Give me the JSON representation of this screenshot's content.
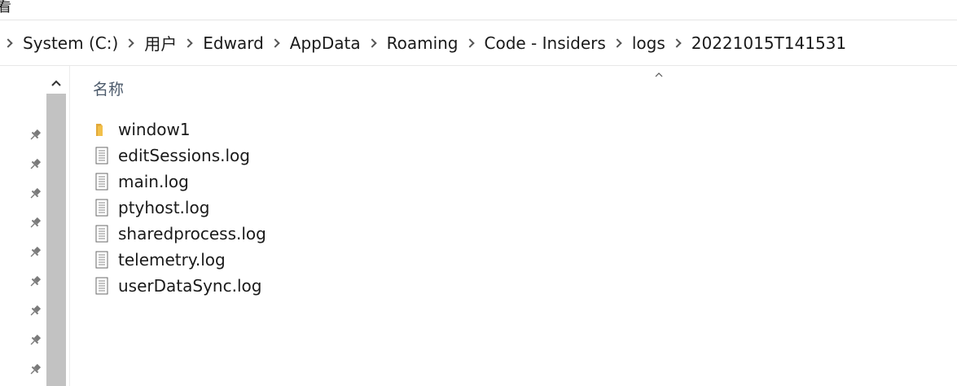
{
  "ribbon": {
    "fragment": "看"
  },
  "breadcrumb": {
    "items": [
      "System (C:)",
      "用户",
      "Edward",
      "AppData",
      "Roaming",
      "Code - Insiders",
      "logs",
      "20221015T141531"
    ]
  },
  "columns": {
    "name_header": "名称"
  },
  "files": [
    {
      "name": "window1",
      "type": "folder",
      "icon": "folder-icon"
    },
    {
      "name": "editSessions.log",
      "type": "file",
      "icon": "document-icon"
    },
    {
      "name": "main.log",
      "type": "file",
      "icon": "document-icon"
    },
    {
      "name": "ptyhost.log",
      "type": "file",
      "icon": "document-icon"
    },
    {
      "name": "sharedprocess.log",
      "type": "file",
      "icon": "document-icon"
    },
    {
      "name": "telemetry.log",
      "type": "file",
      "icon": "document-icon"
    },
    {
      "name": "userDataSync.log",
      "type": "file",
      "icon": "document-icon"
    }
  ],
  "quick_access": {
    "pinned_count": 9,
    "icon": "pin-icon"
  },
  "colors": {
    "folder": "#f2c04a",
    "scroll_thumb": "#c2c2c2",
    "header_text": "#4c5a6b"
  }
}
